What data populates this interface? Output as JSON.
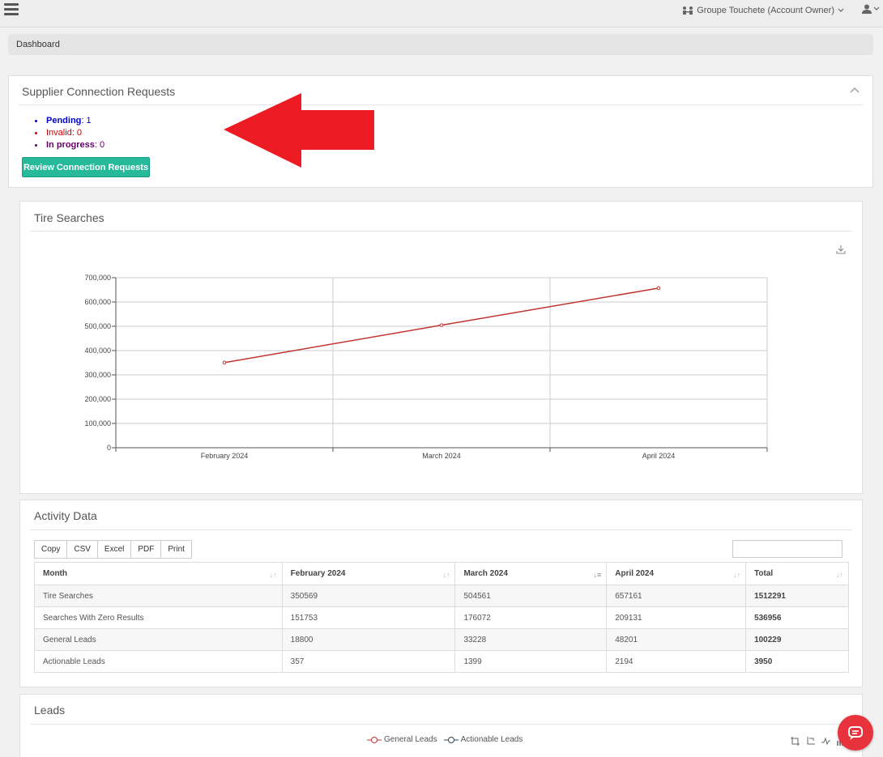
{
  "topbar": {
    "account_label": "Groupe Touchete (Account Owner)"
  },
  "breadcrumb": {
    "current": "Dashboard"
  },
  "supplier_panel": {
    "title": "Supplier Connection Requests",
    "statuses": [
      {
        "label": "Pending",
        "value": ": 1",
        "color": "#0000cc"
      },
      {
        "label": "Invalid",
        "value": ": 0",
        "color": "#cc0000"
      },
      {
        "label": "In progress",
        "value": ": 0",
        "color": "#660066"
      }
    ],
    "review_button": "Review Connection Requests"
  },
  "tire_panel": {
    "title": "Tire Searches"
  },
  "chart_data": {
    "type": "line",
    "categories": [
      "February 2024",
      "March 2024",
      "April 2024"
    ],
    "series": [
      {
        "values": [
          350569,
          504561,
          657161
        ],
        "color": "#c23531"
      }
    ],
    "ylim": [
      0,
      700000
    ],
    "yticks": [
      0,
      100000,
      200000,
      300000,
      400000,
      500000,
      600000,
      700000
    ],
    "ytick_labels": [
      "0",
      "100,000",
      "200,000",
      "300,000",
      "400,000",
      "500,000",
      "600,000",
      "700,000"
    ],
    "grid": true
  },
  "activity_panel": {
    "title": "Activity Data",
    "export_buttons": [
      "Copy",
      "CSV",
      "Excel",
      "PDF",
      "Print"
    ],
    "columns": [
      "Month",
      "February 2024",
      "March 2024",
      "April 2024",
      "Total"
    ],
    "rows": [
      [
        "Tire Searches",
        "350569",
        "504561",
        "657161",
        "1512291"
      ],
      [
        "Searches With Zero Results",
        "151753",
        "176072",
        "209131",
        "536956"
      ],
      [
        "General Leads",
        "18800",
        "33228",
        "48201",
        "100229"
      ],
      [
        "Actionable Leads",
        "357",
        "1399",
        "2194",
        "3950"
      ]
    ]
  },
  "leads_panel": {
    "title": "Leads",
    "legend": [
      "General Leads",
      "Actionable Leads"
    ]
  }
}
